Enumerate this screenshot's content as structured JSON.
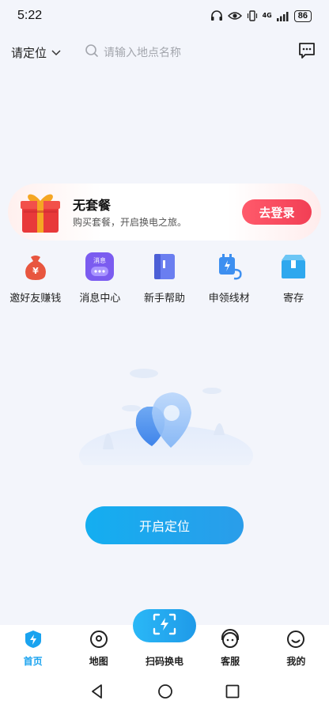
{
  "status_bar": {
    "time": "5:22",
    "network": "4G",
    "battery": "86"
  },
  "top_bar": {
    "location_label": "请定位",
    "search_placeholder": "请输入地点名称"
  },
  "package": {
    "title": "无套餐",
    "subtitle": "购买套餐，开启换电之旅。",
    "login_label": "去登录"
  },
  "quick_actions": [
    {
      "label": "邀好友赚钱",
      "icon": "money-bag-icon"
    },
    {
      "label": "消息中心",
      "icon": "message-center-icon",
      "badge_text": "消息"
    },
    {
      "label": "新手帮助",
      "icon": "help-book-icon"
    },
    {
      "label": "申领线材",
      "icon": "charging-cable-icon"
    },
    {
      "label": "寄存",
      "icon": "storage-box-icon"
    }
  ],
  "main": {
    "open_location_label": "开启定位"
  },
  "bottom_nav": [
    {
      "label": "首页",
      "icon": "home-bolt-icon",
      "active": true
    },
    {
      "label": "地图",
      "icon": "map-pin-icon"
    },
    {
      "label": "扫码换电",
      "icon": "scan-bolt-icon"
    },
    {
      "label": "客服",
      "icon": "customer-service-icon"
    },
    {
      "label": "我的",
      "icon": "smile-face-icon"
    }
  ],
  "colors": {
    "accent": "#1aa3ef",
    "login": "#f23f55",
    "background": "#f3f5fb"
  }
}
